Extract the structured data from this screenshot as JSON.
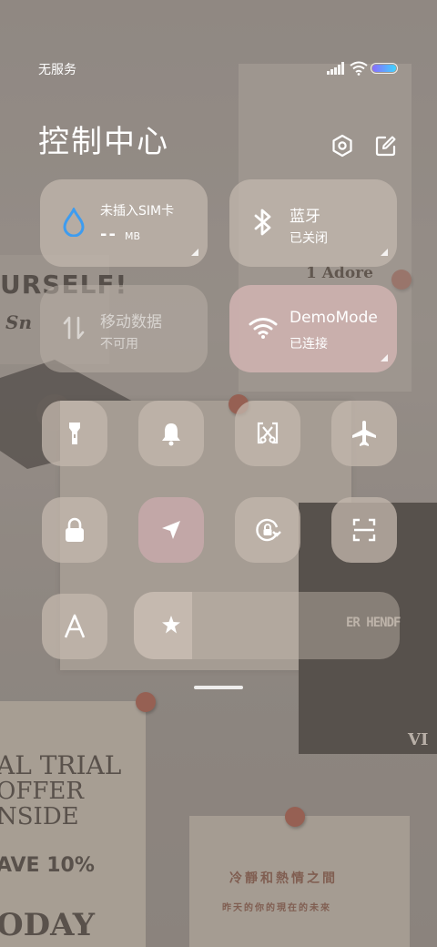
{
  "status_bar": {
    "carrier_text": "无服务"
  },
  "header": {
    "title": "控制中心"
  },
  "tiles": {
    "sim": {
      "title": "未插入SIM卡",
      "value": "--",
      "unit": "MB"
    },
    "bluetooth": {
      "title": "蓝牙",
      "status": "已关闭"
    },
    "mobile_data": {
      "title": "移动数据",
      "status": "不可用"
    },
    "wifi": {
      "title": "DemoMode",
      "status": "已连接"
    }
  },
  "toggles": [
    {
      "id": "flashlight",
      "icon": "flashlight-icon",
      "active": false
    },
    {
      "id": "sound",
      "icon": "bell-icon",
      "active": false
    },
    {
      "id": "screenshot",
      "icon": "scissors-icon",
      "active": false
    },
    {
      "id": "airplane",
      "icon": "airplane-icon",
      "active": false
    },
    {
      "id": "lock",
      "icon": "lock-icon",
      "active": false
    },
    {
      "id": "location",
      "icon": "location-arrow-icon",
      "active": true
    },
    {
      "id": "rotation-lock",
      "icon": "rotation-lock-icon",
      "active": false
    },
    {
      "id": "scanner",
      "icon": "scan-icon",
      "active": false
    },
    {
      "id": "font-size",
      "icon": "font-a-icon",
      "active": false
    }
  ],
  "brightness": {
    "level": 0.22,
    "icon": "brightness-sun-icon"
  },
  "wallpaper_text": {
    "poster_top_left_line1": "URSELF!",
    "poster_top_left_line2": "Sn",
    "poster_right": "1 Adore",
    "poster_dark": "ER HENDF",
    "poster_dark_small": "VI",
    "poster_bottom_left": [
      "AL TRIAL",
      "OFFER",
      "NSIDE",
      "AVE 10%",
      "ODAY"
    ],
    "poster_bottom_right_line1": "冷靜和熱情之間",
    "poster_bottom_right_line2": "昨天的你的現在的未來"
  },
  "colors": {
    "sim_drop_icon": "#3d9cf0",
    "active_tile": "#cbb0ae",
    "battery_gradient": [
      "#8a6cff",
      "#3fd4ff"
    ]
  }
}
